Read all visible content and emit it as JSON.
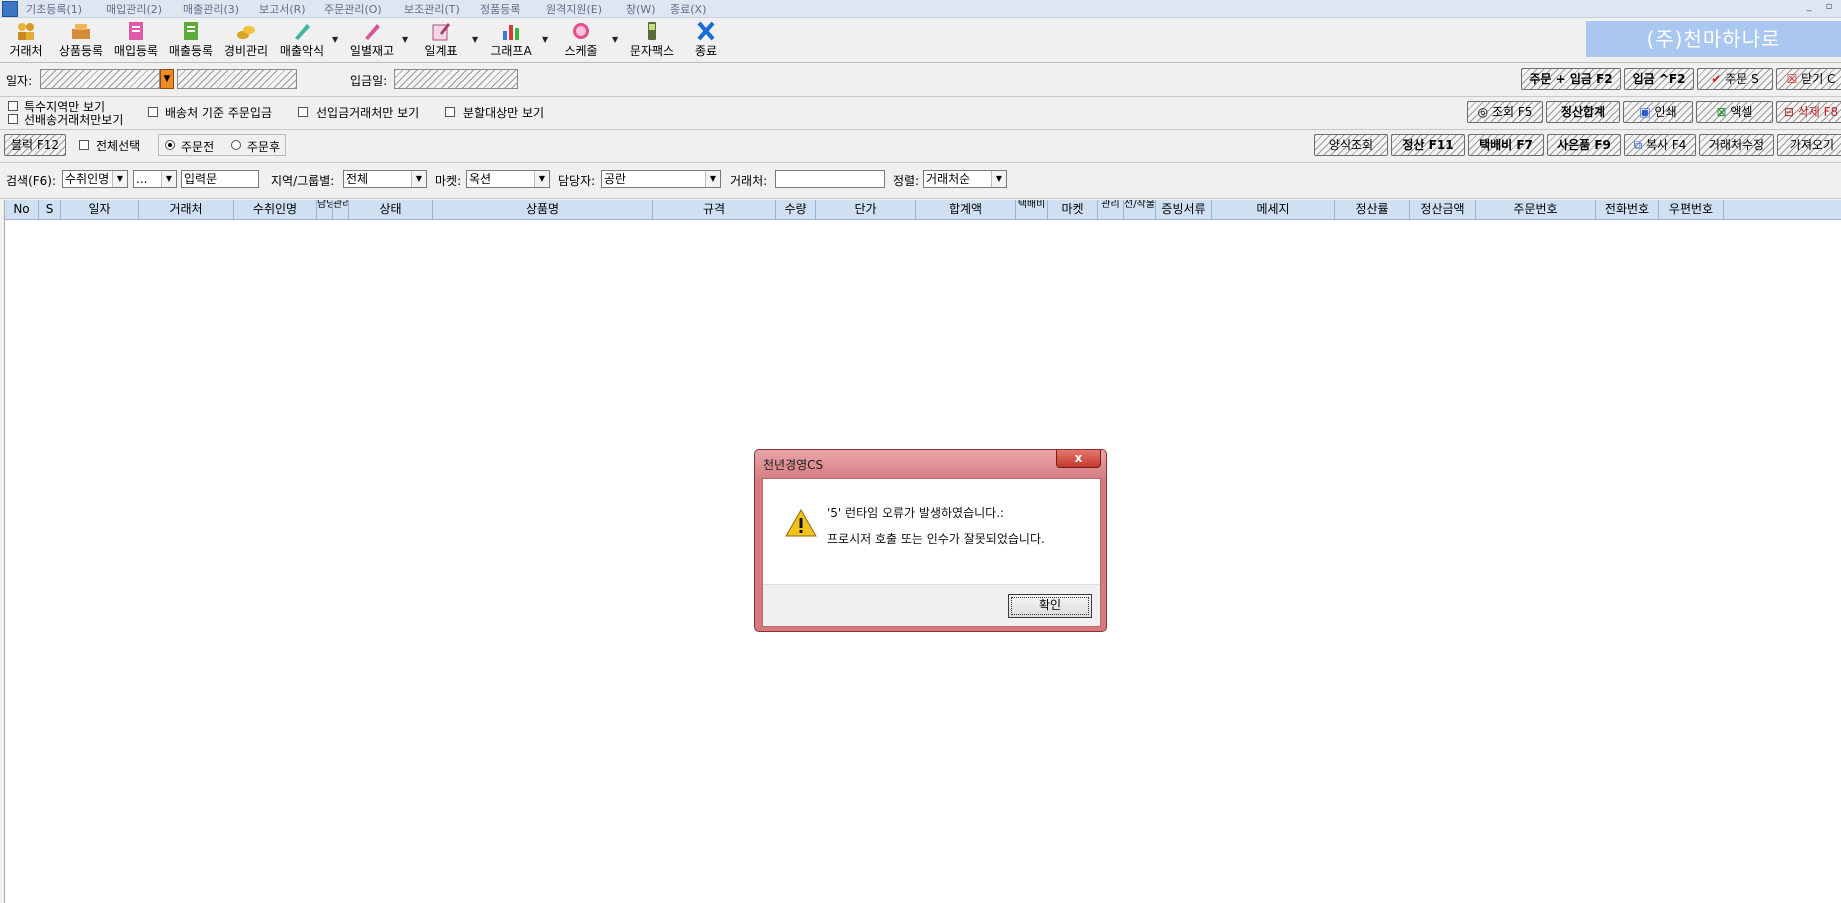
{
  "menubar": {
    "items": [
      "기초등록(1)",
      "매입관리(2)",
      "매출관리(3)",
      "보고서(R)",
      "주문관리(O)",
      "보조관리(T)",
      "정품등록",
      "원격지원(E)",
      "창(W)",
      "종료(X)"
    ]
  },
  "toolbar": {
    "buttons": [
      "거래처",
      "상품등록",
      "매입등록",
      "매출등록",
      "경비관리",
      "매출악식",
      "일별재고",
      "일계표",
      "그래프A",
      "스케줄",
      "문자팩스",
      "종료"
    ]
  },
  "company_name": "(주)천마하나로",
  "date_row": {
    "date_label": "일자:",
    "deposit_label": "입금일:",
    "buttons": [
      "주문 + 입금 F2",
      "입금 ^F2",
      "주문 S",
      "닫기 C"
    ]
  },
  "filter_row": {
    "checks": [
      "특수지역만 보기",
      "선배송거래처만보기",
      "배송처 기준 주문입금",
      "선입금거래처만 보기",
      "분할대상만 보기"
    ],
    "buttons": [
      "조회 F5",
      "정산합계",
      "인쇄",
      "엑셀",
      "삭제 F8"
    ]
  },
  "action_row": {
    "block_button": "블럭 F12",
    "select_all": "전체선택",
    "radio_before": "주문전",
    "radio_after": "주문후",
    "buttons": [
      "양식조회",
      "정산 F11",
      "택배비 F7",
      "사은품 F9",
      "복사 F4",
      "거래처수정",
      "가져오기"
    ]
  },
  "search_row": {
    "search_label": "검색(F6):",
    "search_field": "수취인명",
    "search_op": "...",
    "search_value": "입력문",
    "region_label": "지역/그룹별:",
    "region_value": "전체",
    "market_label": "마켓:",
    "market_value": "옥션",
    "manager_label": "담당자:",
    "manager_value": "공란",
    "client_label": "거래처:",
    "sort_label": "정렬:",
    "sort_value": "거래처순"
  },
  "grid": {
    "columns": [
      "No",
      "S",
      "일자",
      "거래처",
      "수취인명",
      "담당",
      "관리",
      "상태",
      "상품명",
      "규격",
      "수량",
      "단가",
      "합계액",
      "택배비",
      "마켓",
      "관리",
      "선/착불",
      "증빙서류",
      "메세지",
      "정산률",
      "정산금액",
      "주문번호",
      "전화번호",
      "우편번호"
    ]
  },
  "dialog": {
    "title": "천년경영CS",
    "close": "x",
    "line1": "'5' 런타임 오류가 발생하였습니다.:",
    "line2": "프로시저 호출 또는 인수가 잘못되었습니다.",
    "ok": "확인"
  }
}
